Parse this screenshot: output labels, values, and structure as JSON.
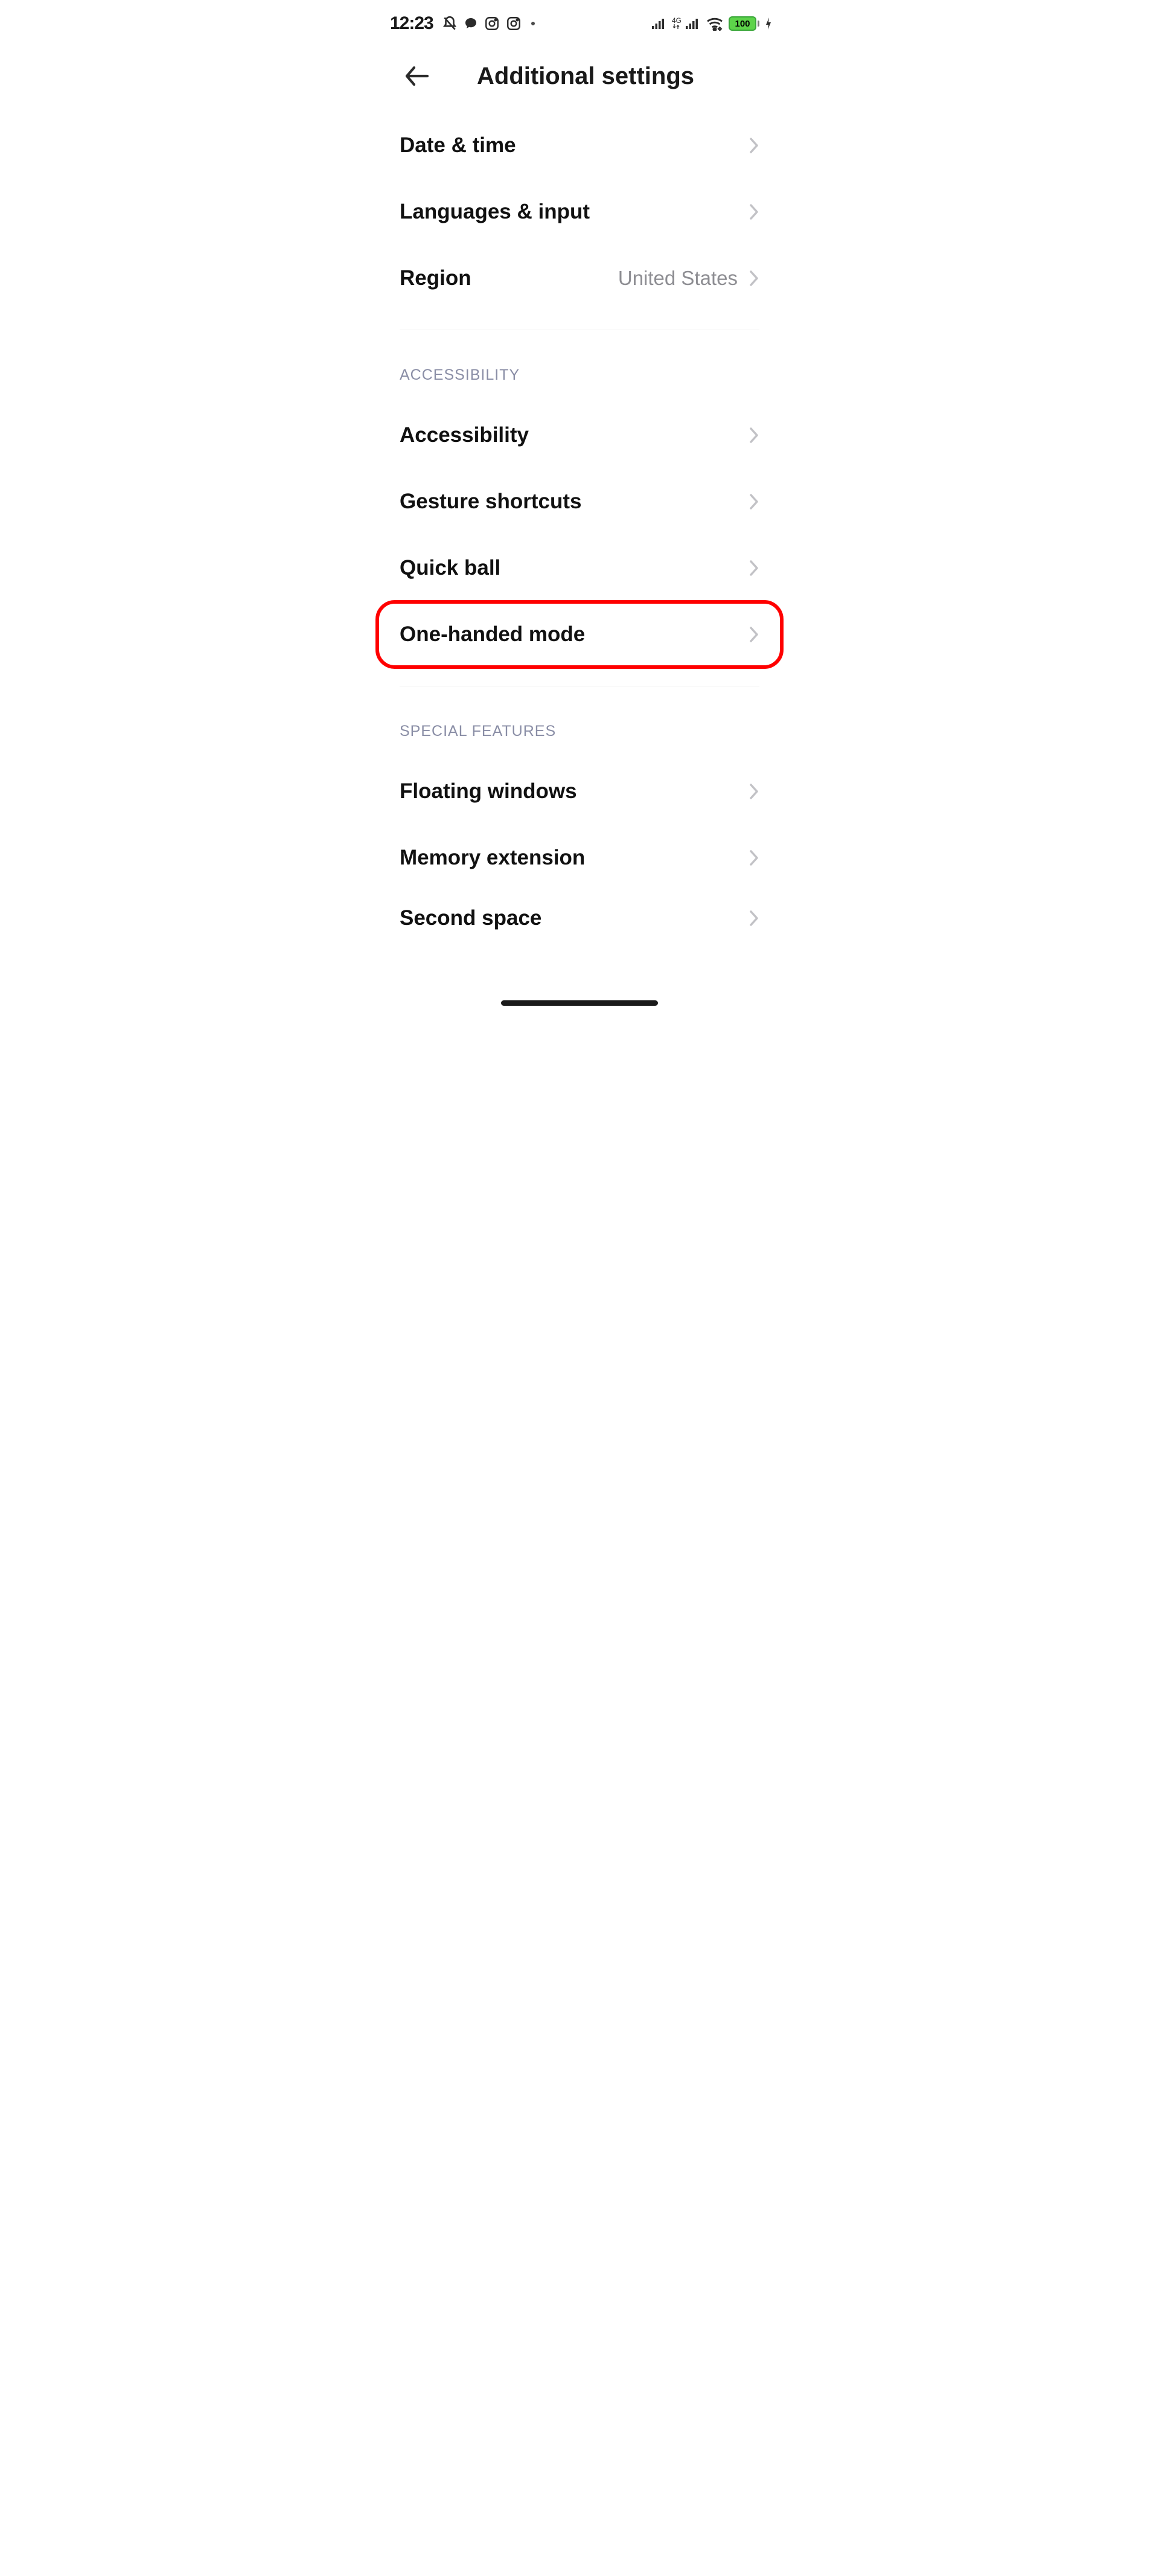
{
  "status": {
    "time": "12:23",
    "battery": "100",
    "network_label": "4G"
  },
  "header": {
    "title": "Additional settings"
  },
  "rows": {
    "date_time": "Date & time",
    "languages": "Languages & input",
    "region": "Region",
    "region_value": "United States",
    "accessibility": "Accessibility",
    "gesture": "Gesture shortcuts",
    "quick_ball": "Quick ball",
    "one_handed": "One-handed mode",
    "floating": "Floating windows",
    "memory": "Memory extension",
    "second_space": "Second space"
  },
  "sections": {
    "accessibility": "ACCESSIBILITY",
    "special_features": "SPECIAL FEATURES"
  }
}
